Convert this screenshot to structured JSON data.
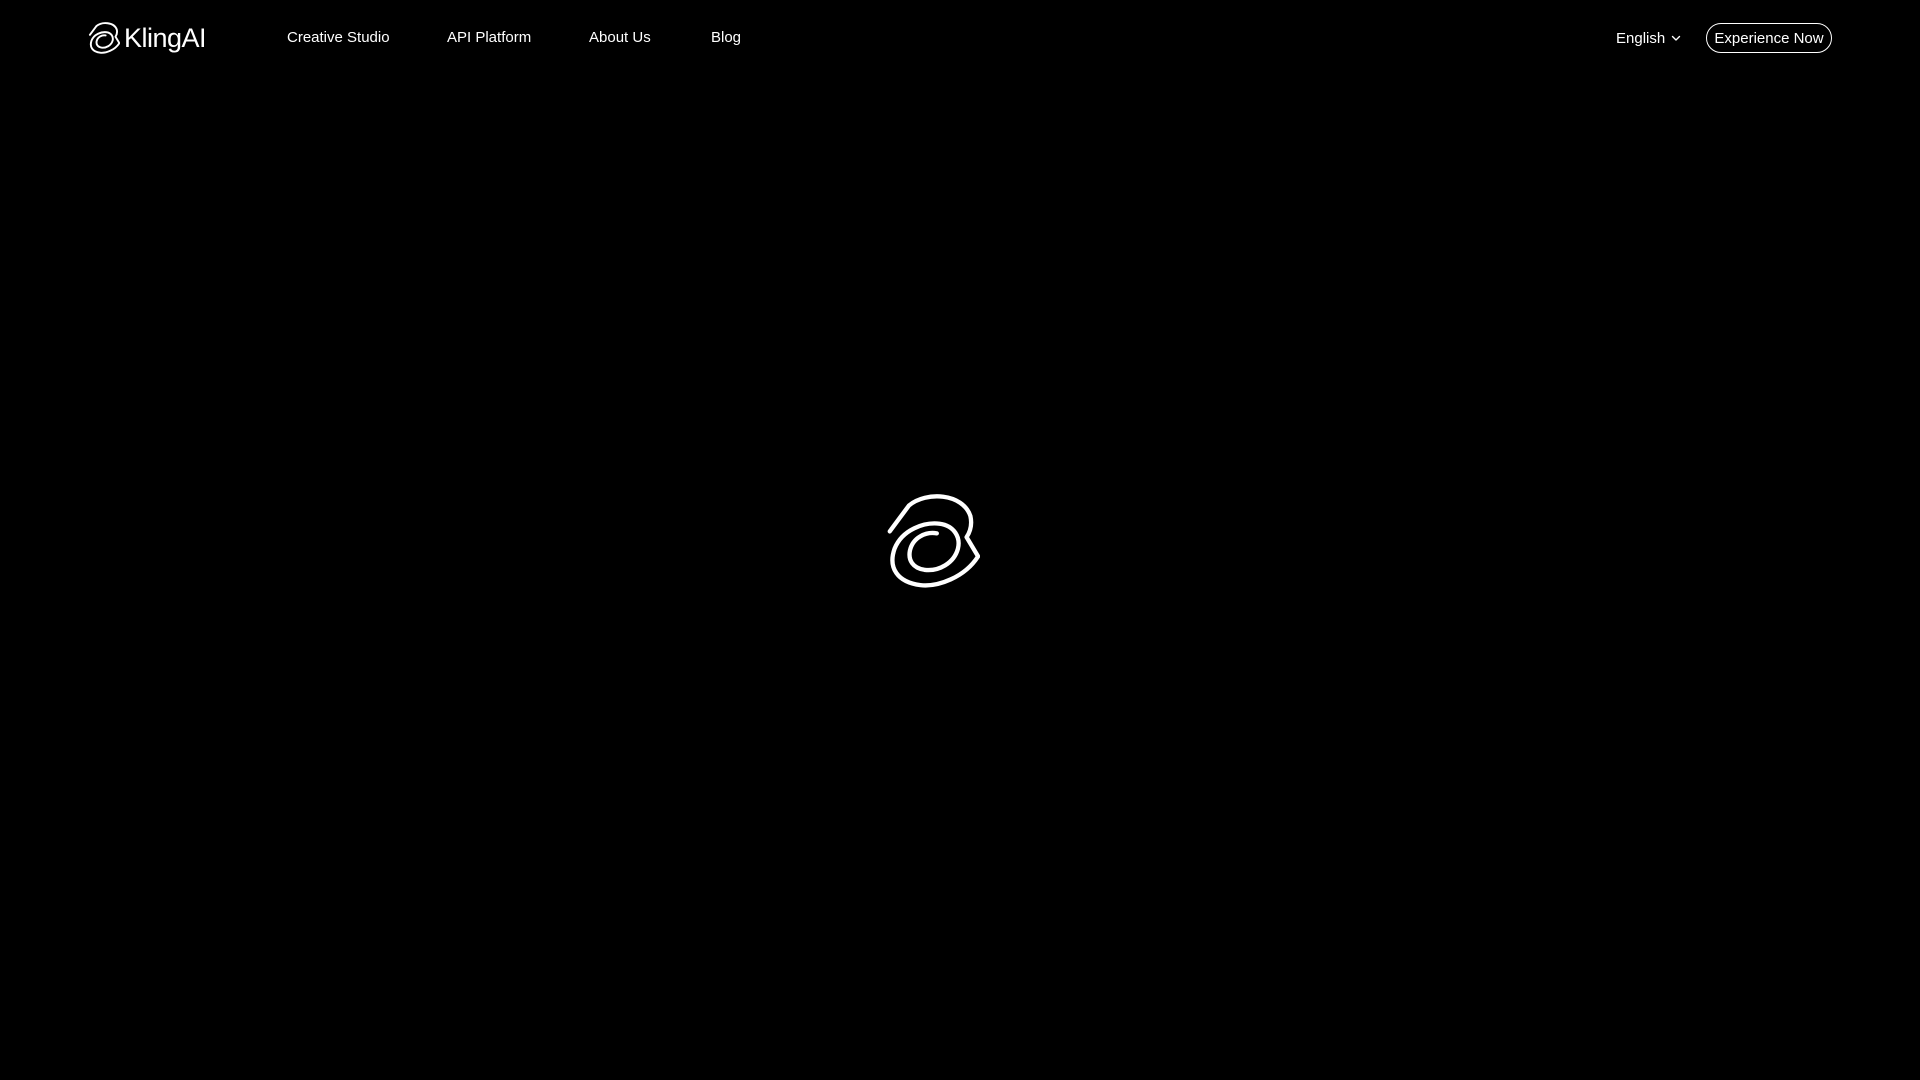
{
  "header": {
    "logo_text": "KlingAI",
    "logo_icon": "kling-logo-icon",
    "nav": [
      {
        "label": "Creative Studio"
      },
      {
        "label": "API Platform"
      },
      {
        "label": "About Us"
      },
      {
        "label": "Blog"
      }
    ],
    "language": {
      "selected": "English",
      "icon": "chevron-down-icon"
    },
    "cta_label": "Experience Now"
  },
  "main": {
    "loader_icon": "kling-logo-loader-icon"
  },
  "colors": {
    "background": "#000000",
    "foreground": "#ffffff"
  }
}
